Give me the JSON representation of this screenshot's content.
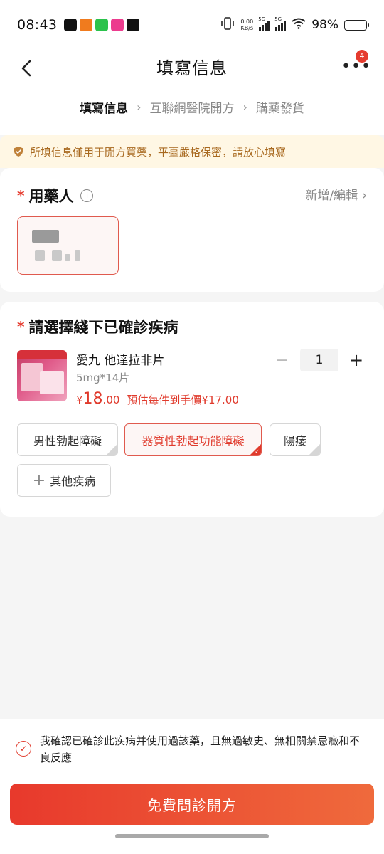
{
  "status_bar": {
    "time": "08:43",
    "net_speed_value": "0.00",
    "net_speed_unit": "KB/s",
    "signal1_label": "5G",
    "signal2_label": "5G",
    "battery": "98%",
    "battery_level": 0.98
  },
  "nav": {
    "title": "填寫信息",
    "more_badge": "4",
    "steps": [
      "填寫信息",
      "互聯網醫院開方",
      "購藥發貨"
    ]
  },
  "notice": {
    "text": "所填信息僅用于開方買藥，平臺嚴格保密，請放心填寫"
  },
  "patient_section": {
    "required_mark": "*",
    "title": "用藥人",
    "info_icon": "i",
    "add_edit": "新增/編輯",
    "chevron": "›"
  },
  "disease_section": {
    "required_mark": "*",
    "title": "請選擇綫下已確診疾病",
    "product": {
      "name": "愛九 他達拉非片",
      "spec": "5mg*14片",
      "price_currency": "¥",
      "price_int": "18",
      "price_dec": ".00",
      "estimate": "預估每件到手價¥17.00"
    },
    "stepper": {
      "minus": "−",
      "quantity": "1",
      "plus": "+"
    },
    "tags": [
      {
        "label": "男性勃起障礙",
        "selected": false
      },
      {
        "label": "器質性勃起功能障礙",
        "selected": true
      },
      {
        "label": "陽痿",
        "selected": false
      }
    ],
    "other_tag": {
      "plus": "+",
      "label": "其他疾病"
    }
  },
  "bottom": {
    "consent_checked": true,
    "consent_text": "我確認已確診此疾病并使用過該藥，且無過敏史、無相關禁忌癥和不良反應",
    "cta_label": "免費問診開方"
  },
  "colors": {
    "accent": "#e03a2c",
    "notice_bg": "#fff7e4",
    "notice_text": "#a8691f"
  },
  "icons": [
    "back-arrow-icon",
    "more-dots-icon",
    "shield-check-icon",
    "info-icon",
    "chevron-right-icon",
    "check-circle-icon"
  ]
}
